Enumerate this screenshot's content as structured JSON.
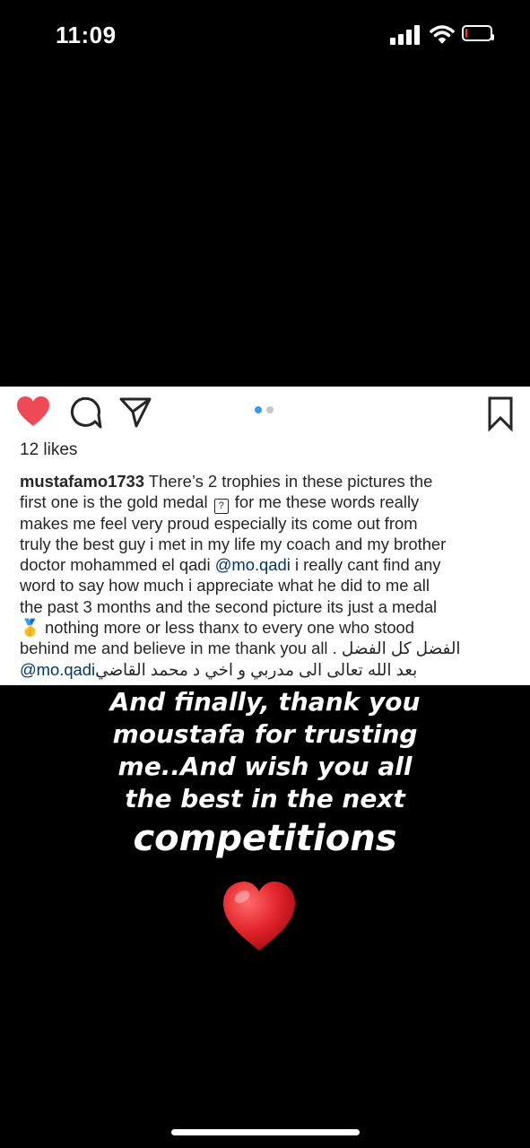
{
  "status_bar": {
    "time": "11:09",
    "signal_icon": "cellular-signal-icon",
    "wifi_icon": "wifi-icon",
    "battery_icon": "battery-icon",
    "battery_level": 0.08,
    "battery_color": "#ff3b30"
  },
  "post": {
    "actions": {
      "like_icon": "heart-filled-icon",
      "like_color": "#ed4956",
      "comment_icon": "comment-icon",
      "share_icon": "paper-plane-icon",
      "save_icon": "bookmark-icon"
    },
    "carousel": {
      "total": 2,
      "active": 1,
      "active_color": "#3897f0",
      "inactive_color": "#c7c7c7"
    },
    "likes": "12 likes",
    "caption": {
      "username": "mustafamo1733",
      "lines": {
        "l1": " There’s 2 trophies in these pictures the",
        "l2a": "first one is the gold medal ",
        "l2_box": "?",
        "l2b": " for me these words really",
        "l3": "makes  me feel very proud especially its come out from",
        "l4": "truly the best guy i met in my life my coach and my brother",
        "l5a": "doctor mohammed el qadi ",
        "l5_mention": "@mo.qadi",
        "l5b": " i really cant find any",
        "l6": "word to say how much i appreciate what he did to me all",
        "l7": "the past 3 months and the second picture its just a medal",
        "l8_emoji": "🥇",
        "l8": "  nothing more or less thanx to every one who stood",
        "l9a": "behind me and believe in me thank you all . ",
        "l9_arabic": "الفضل كل الفضل",
        "l10_mention": "@mo.qadi",
        "l10_arabic": " بعد الله تعالى الى مدربي و اخي  د محمد القاضي"
      },
      "mention_color": "#00376b"
    }
  },
  "story_overlay": {
    "lines": [
      "And finally, thank you",
      "moustafa for trusting",
      "me..And wish you all",
      "the best in the next",
      "competitions"
    ],
    "emoji_icon": "red-heart-emoji-icon",
    "emoji_color": "#e3242b"
  },
  "home_indicator": "home-indicator"
}
